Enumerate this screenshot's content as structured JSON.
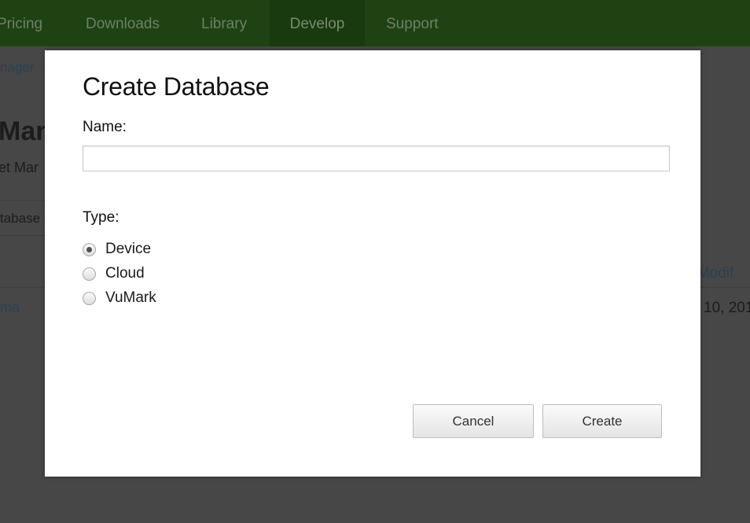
{
  "nav": {
    "items": [
      {
        "label": "Pricing",
        "active": false
      },
      {
        "label": "Downloads",
        "active": false
      },
      {
        "label": "Library",
        "active": false
      },
      {
        "label": "Develop",
        "active": true
      },
      {
        "label": "Support",
        "active": false
      }
    ]
  },
  "background": {
    "breadcrumb": "nager",
    "heading": "Man",
    "subheading": "et Mar",
    "tab_label": "tabase",
    "column_header": "e Modif",
    "row_name": "ma",
    "row_date": "10, 201"
  },
  "dialog": {
    "title": "Create Database",
    "name_label": "Name:",
    "name_value": "",
    "name_placeholder": "",
    "type_label": "Type:",
    "options": [
      {
        "label": "Device",
        "selected": true
      },
      {
        "label": "Cloud",
        "selected": false
      },
      {
        "label": "VuMark",
        "selected": false
      }
    ],
    "cancel_label": "Cancel",
    "create_label": "Create"
  },
  "colors": {
    "nav_bar": "#1e4212",
    "overlay": "#474747",
    "dialog_bg": "#ffffff"
  }
}
